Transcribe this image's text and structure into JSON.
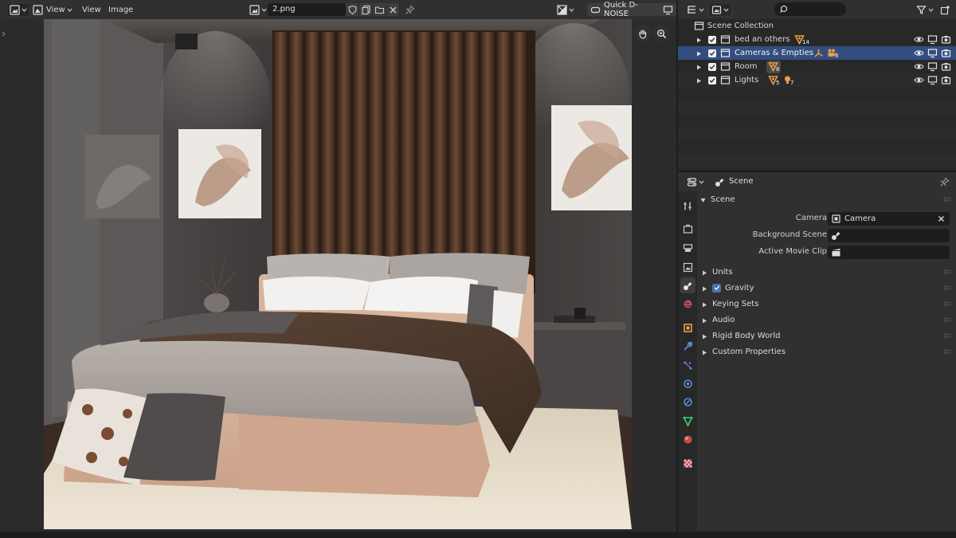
{
  "image_editor": {
    "header": {
      "view_menu_1": "View",
      "view_menu_2": "View",
      "image_menu": "Image",
      "image_name": "2.png",
      "quick_denoise_label": "Quick D-NOISE"
    }
  },
  "outliner": {
    "root": "Scene Collection",
    "rows": [
      {
        "name": "bed an others",
        "count": "14"
      },
      {
        "name": "Cameras & Empties",
        "count": "3"
      },
      {
        "name": "Room",
        "count": "8"
      },
      {
        "name": "Lights",
        "count_mesh": "5",
        "count_light": "7"
      }
    ]
  },
  "properties": {
    "header_title": "Scene",
    "panel_title": "Scene",
    "fields": {
      "camera_label": "Camera",
      "camera_value": "Camera",
      "background_scene_label": "Background Scene",
      "active_movie_clip_label": "Active Movie Clip"
    },
    "subpanels": {
      "units": "Units",
      "gravity": "Gravity",
      "keying_sets": "Keying Sets",
      "audio": "Audio",
      "rigid_body_world": "Rigid Body World",
      "custom_properties": "Custom Properties"
    }
  },
  "colors": {
    "selected_row": "#334d80",
    "accent_blue": "#4772b3",
    "orange_icon": "#e8a040"
  }
}
